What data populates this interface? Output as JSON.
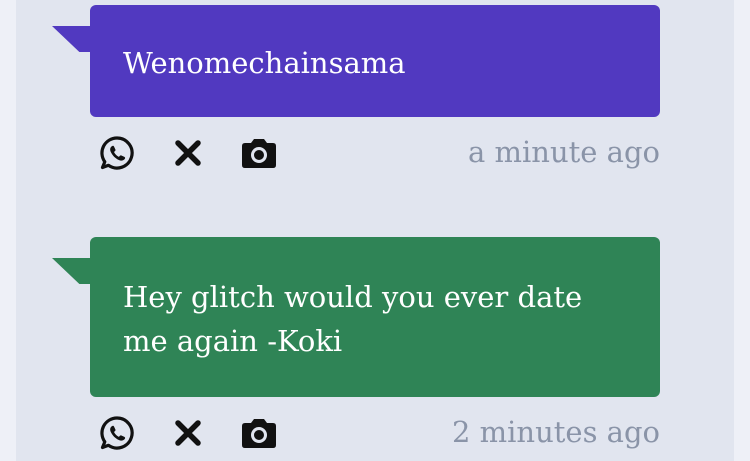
{
  "posts": [
    {
      "message": "Wenomechainsama",
      "color": "#5139c0",
      "time": "a minute ago",
      "actions": [
        "whatsapp-icon",
        "x-icon",
        "camera-icon"
      ]
    },
    {
      "message": "Hey glitch would you ever date me again -Koki",
      "color": "#2f8456",
      "time": "2 minutes ago",
      "actions": [
        "whatsapp-icon",
        "x-icon",
        "camera-icon"
      ]
    }
  ]
}
